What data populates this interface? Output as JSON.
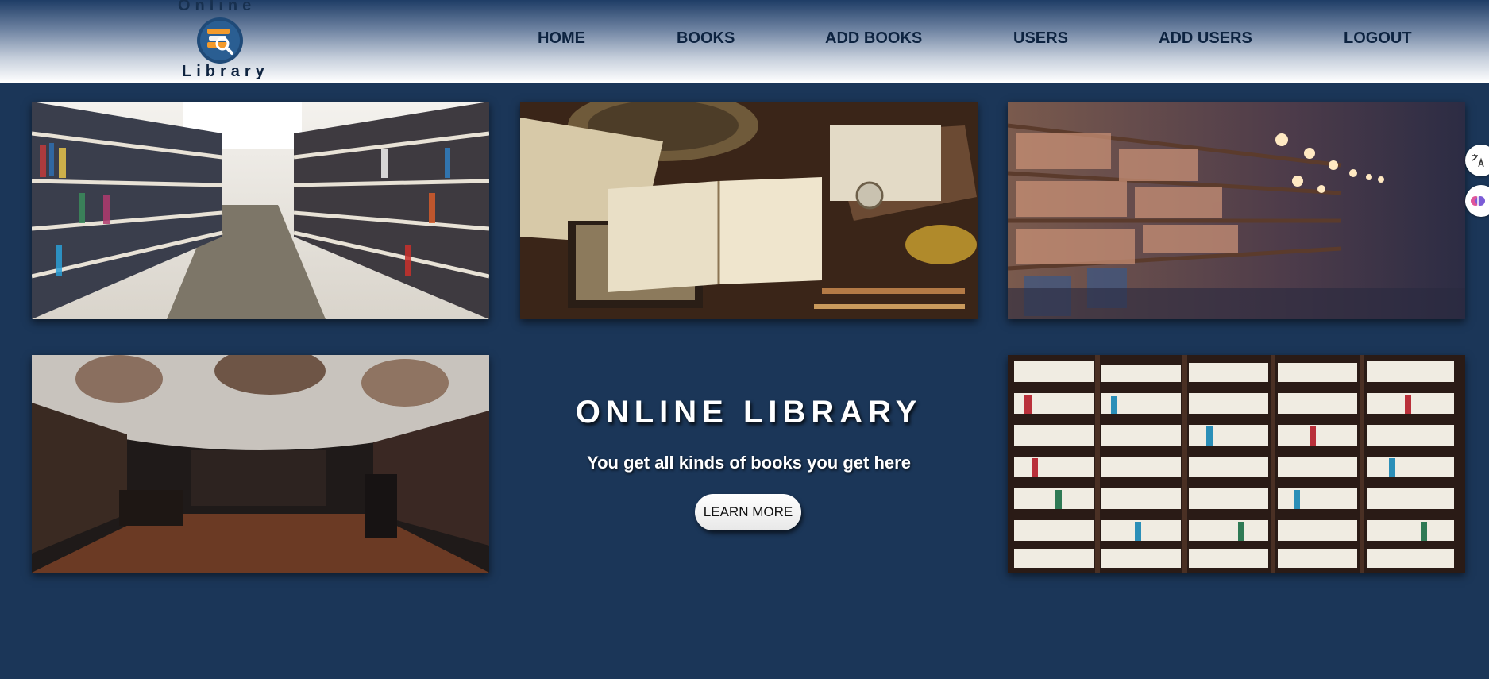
{
  "logo": {
    "top_text": "Online",
    "bottom_text": "Library",
    "icon": "book-search-icon"
  },
  "nav": {
    "items": [
      {
        "label": "HOME"
      },
      {
        "label": "BOOKS"
      },
      {
        "label": "ADD BOOKS"
      },
      {
        "label": "USERS"
      },
      {
        "label": "ADD USERS"
      },
      {
        "label": "LOGOUT"
      }
    ]
  },
  "hero": {
    "title": "ONLINE LIBRARY",
    "subtitle": "You get all kinds of books you get here",
    "button_label": "LEARN MORE"
  },
  "gallery": [
    {
      "subject": "library-aisle-photo"
    },
    {
      "subject": "open-books-and-maps-photo"
    },
    {
      "subject": "warm-lit-bookshelves-photo"
    },
    {
      "subject": "baroque-library-hall-photo"
    },
    {
      "subject": "bookcase-wall-photo"
    }
  ],
  "side_widgets": [
    {
      "icon": "translate-icon"
    },
    {
      "icon": "ai-brain-icon"
    }
  ],
  "colors": {
    "page_bg": "#1b3658",
    "nav_text": "#0d2340",
    "hero_text": "#ffffff"
  }
}
